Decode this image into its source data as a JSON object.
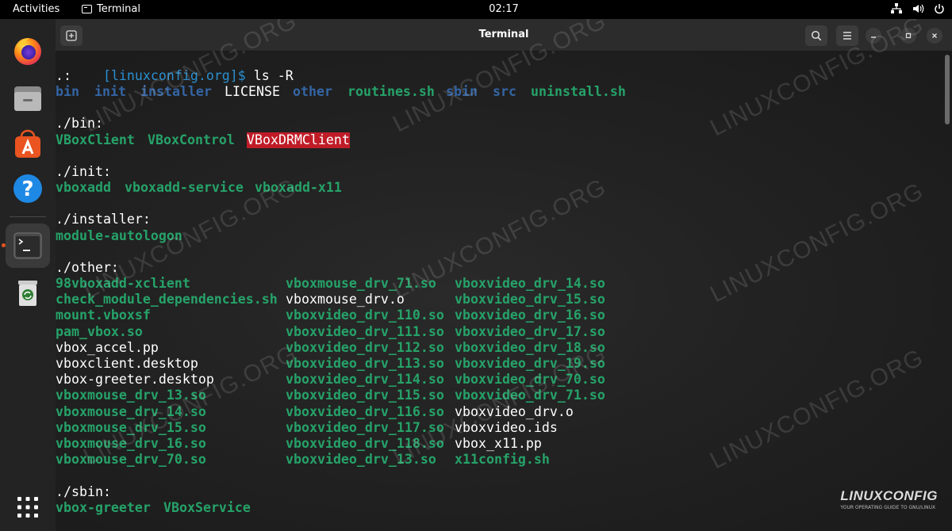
{
  "topbar": {
    "activities": "Activities",
    "app_name": "Terminal",
    "clock": "02:17"
  },
  "dock": {
    "items": [
      "firefox-icon",
      "files-icon",
      "app-center-icon",
      "help-icon",
      "terminal-icon",
      "trash-icon",
      "app-grid-icon"
    ]
  },
  "window": {
    "title": "Terminal"
  },
  "terminal": {
    "prompt": "[linuxconfig.org]$",
    "command": " ls -R",
    "root_header": ".:",
    "root_entries": [
      {
        "name": "bin",
        "kind": "dir"
      },
      {
        "name": "init",
        "kind": "dir"
      },
      {
        "name": "installer",
        "kind": "dir"
      },
      {
        "name": "LICENSE",
        "kind": "file"
      },
      {
        "name": "other",
        "kind": "dir"
      },
      {
        "name": "routines.sh",
        "kind": "exec"
      },
      {
        "name": "sbin",
        "kind": "dir"
      },
      {
        "name": "src",
        "kind": "dir"
      },
      {
        "name": "uninstall.sh",
        "kind": "exec"
      }
    ],
    "bin_header": "./bin:",
    "bin_entries": [
      "VBoxClient",
      "VBoxControl",
      "VBoxDRMClient"
    ],
    "init_header": "./init:",
    "init_entries": [
      "vboxadd",
      "vboxadd-service",
      "vboxadd-x11"
    ],
    "installer_header": "./installer:",
    "installer_entries": [
      "module-autologon"
    ],
    "other_header": "./other:",
    "other_col1": [
      {
        "name": "98vboxadd-xclient",
        "kind": "exec"
      },
      {
        "name": "check_module_dependencies.sh",
        "kind": "exec"
      },
      {
        "name": "mount.vboxsf",
        "kind": "exec"
      },
      {
        "name": "pam_vbox.so",
        "kind": "exec"
      },
      {
        "name": "vbox_accel.pp",
        "kind": "file"
      },
      {
        "name": "vboxclient.desktop",
        "kind": "file"
      },
      {
        "name": "vbox-greeter.desktop",
        "kind": "file"
      },
      {
        "name": "vboxmouse_drv_13.so",
        "kind": "exec"
      },
      {
        "name": "vboxmouse_drv_14.so",
        "kind": "exec"
      },
      {
        "name": "vboxmouse_drv_15.so",
        "kind": "exec"
      },
      {
        "name": "vboxmouse_drv_16.so",
        "kind": "exec"
      },
      {
        "name": "vboxmouse_drv_70.so",
        "kind": "exec"
      }
    ],
    "other_col2": [
      {
        "name": "vboxmouse_drv_71.so",
        "kind": "exec"
      },
      {
        "name": "vboxmouse_drv.o",
        "kind": "file"
      },
      {
        "name": "vboxvideo_drv_110.so",
        "kind": "exec"
      },
      {
        "name": "vboxvideo_drv_111.so",
        "kind": "exec"
      },
      {
        "name": "vboxvideo_drv_112.so",
        "kind": "exec"
      },
      {
        "name": "vboxvideo_drv_113.so",
        "kind": "exec"
      },
      {
        "name": "vboxvideo_drv_114.so",
        "kind": "exec"
      },
      {
        "name": "vboxvideo_drv_115.so",
        "kind": "exec"
      },
      {
        "name": "vboxvideo_drv_116.so",
        "kind": "exec"
      },
      {
        "name": "vboxvideo_drv_117.so",
        "kind": "exec"
      },
      {
        "name": "vboxvideo_drv_118.so",
        "kind": "exec"
      },
      {
        "name": "vboxvideo_drv_13.so",
        "kind": "exec"
      }
    ],
    "other_col3": [
      {
        "name": "vboxvideo_drv_14.so",
        "kind": "exec"
      },
      {
        "name": "vboxvideo_drv_15.so",
        "kind": "exec"
      },
      {
        "name": "vboxvideo_drv_16.so",
        "kind": "exec"
      },
      {
        "name": "vboxvideo_drv_17.so",
        "kind": "exec"
      },
      {
        "name": "vboxvideo_drv_18.so",
        "kind": "exec"
      },
      {
        "name": "vboxvideo_drv_19.so",
        "kind": "exec"
      },
      {
        "name": "vboxvideo_drv_70.so",
        "kind": "exec"
      },
      {
        "name": "vboxvideo_drv_71.so",
        "kind": "exec"
      },
      {
        "name": "vboxvideo_drv.o",
        "kind": "file"
      },
      {
        "name": "vboxvideo.ids",
        "kind": "file"
      },
      {
        "name": "vbox_x11.pp",
        "kind": "file"
      },
      {
        "name": "x11config.sh",
        "kind": "exec"
      }
    ],
    "sbin_header": "./sbin:",
    "sbin_entries": [
      "vbox-greeter",
      "VBoxService"
    ]
  },
  "watermark": "LINUXCONFIG.ORG",
  "logo": {
    "name": "LINUXCONFIG",
    "tagline": "YOUR OPERATING GUIDE TO GNU/LINUX"
  },
  "colors": {
    "directory": "#3465a4",
    "executable": "#26a269",
    "highlight": "#c01c28",
    "accent": "#e95420"
  }
}
